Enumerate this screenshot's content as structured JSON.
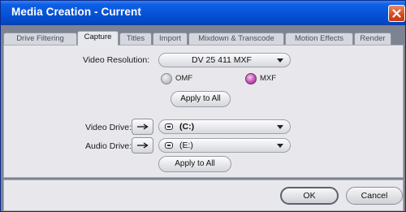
{
  "window": {
    "title": "Media Creation - Current"
  },
  "tabs": [
    {
      "label": "Drive Filtering"
    },
    {
      "label": "Capture"
    },
    {
      "label": "Titles"
    },
    {
      "label": "Import"
    },
    {
      "label": "Mixdown & Transcode"
    },
    {
      "label": "Motion Effects"
    },
    {
      "label": "Render"
    }
  ],
  "active_tab": "Capture",
  "capture": {
    "video_resolution_label": "Video Resolution:",
    "video_resolution_value": "DV 25 411  MXF",
    "format_options": [
      {
        "label": "OMF",
        "selected": false
      },
      {
        "label": "MXF",
        "selected": true
      }
    ],
    "apply_to_all_1": "Apply to All",
    "video_drive_label": "Video Drive:",
    "video_drive_value": "(C:)",
    "audio_drive_label": "Audio Drive:",
    "audio_drive_value": "(E:)",
    "apply_to_all_2": "Apply to All"
  },
  "footer": {
    "ok_label": "OK",
    "cancel_label": "Cancel"
  },
  "icons": {
    "close": "close-icon",
    "arrow": "right-arrow-icon",
    "drive": "drive-icon",
    "dropdown": "chevron-down-icon"
  },
  "colors": {
    "titlebar": "#0552d7",
    "close_button": "#d5481f",
    "selected_radio": "#c455b4"
  }
}
